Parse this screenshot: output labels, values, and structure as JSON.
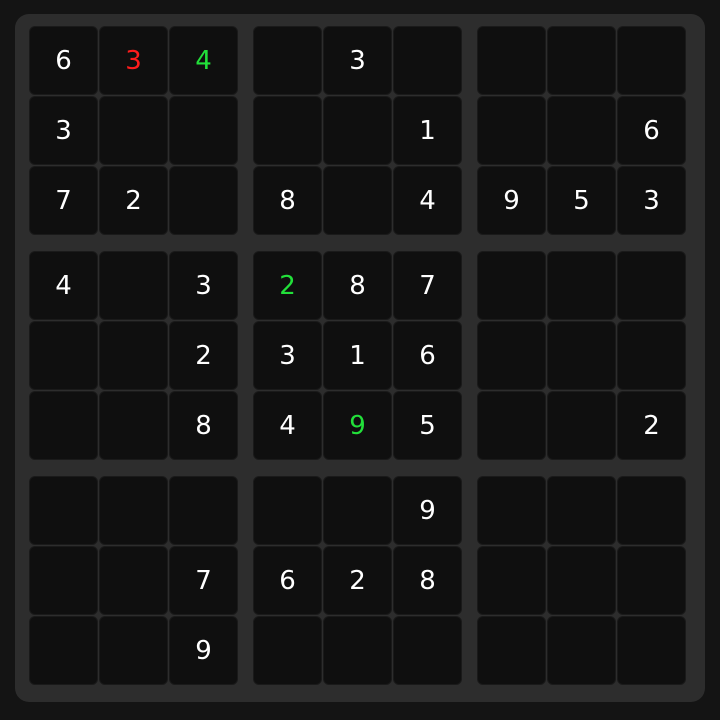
{
  "grid": [
    [
      "6",
      "3",
      "4",
      "",
      "3",
      "",
      "",
      "",
      ""
    ],
    [
      "3",
      "",
      "",
      "",
      "",
      "1",
      "",
      "",
      "6"
    ],
    [
      "7",
      "2",
      "",
      "8",
      "",
      "4",
      "9",
      "5",
      "3"
    ],
    [
      "4",
      "",
      "3",
      "2",
      "8",
      "7",
      "",
      "",
      ""
    ],
    [
      "",
      "",
      "2",
      "3",
      "1",
      "6",
      "",
      "",
      ""
    ],
    [
      "",
      "",
      "8",
      "4",
      "9",
      "5",
      "",
      "",
      "2"
    ],
    [
      "",
      "",
      "",
      "",
      "",
      "9",
      "",
      "",
      ""
    ],
    [
      "",
      "",
      "7",
      "6",
      "2",
      "8",
      "",
      "",
      ""
    ],
    [
      "",
      "",
      "9",
      "",
      "",
      "",
      "",
      "",
      ""
    ]
  ],
  "cell_states": [
    [
      "given",
      "wrong",
      "correct",
      "empty",
      "given",
      "empty",
      "empty",
      "empty",
      "empty"
    ],
    [
      "given",
      "empty",
      "empty",
      "empty",
      "empty",
      "given",
      "empty",
      "empty",
      "given"
    ],
    [
      "given",
      "given",
      "empty",
      "given",
      "empty",
      "given",
      "given",
      "given",
      "given"
    ],
    [
      "given",
      "empty",
      "given",
      "correct",
      "given",
      "given",
      "empty",
      "empty",
      "empty"
    ],
    [
      "empty",
      "empty",
      "given",
      "given",
      "given",
      "given",
      "empty",
      "empty",
      "empty"
    ],
    [
      "empty",
      "empty",
      "given",
      "given",
      "correct",
      "given",
      "empty",
      "empty",
      "given"
    ],
    [
      "empty",
      "empty",
      "empty",
      "empty",
      "empty",
      "given",
      "empty",
      "empty",
      "empty"
    ],
    [
      "empty",
      "empty",
      "given",
      "given",
      "given",
      "given",
      "empty",
      "empty",
      "empty"
    ],
    [
      "empty",
      "empty",
      "given",
      "empty",
      "empty",
      "empty",
      "empty",
      "empty",
      "empty"
    ]
  ],
  "colors": {
    "given": "#ffffff",
    "correct": "#22e03a",
    "wrong": "#ff1c1c",
    "cell_bg": "#0f0f0f",
    "board_bg": "#2d2d2d",
    "page_bg": "#141414"
  }
}
